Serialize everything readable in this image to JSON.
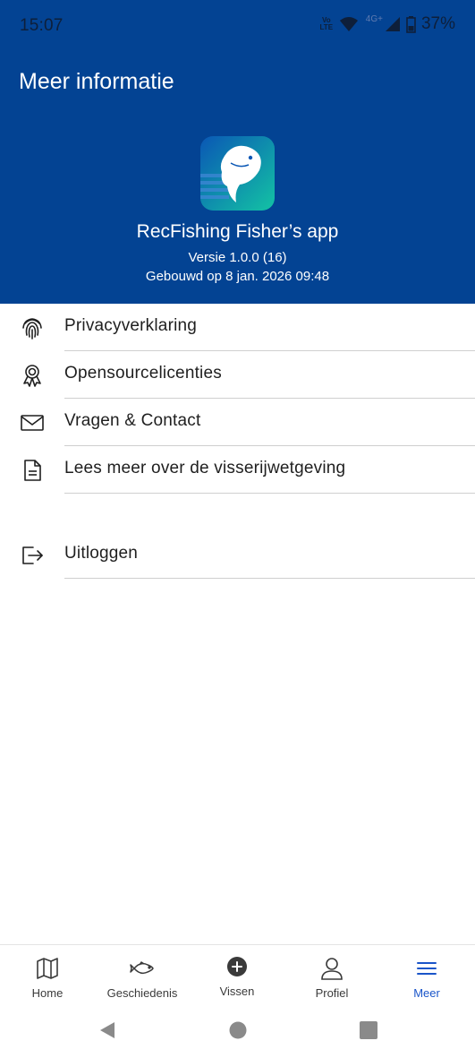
{
  "status_bar": {
    "time": "15:07",
    "volte": "Vo LTE",
    "network": "4G+",
    "battery": "37%"
  },
  "header": {
    "title": "Meer informatie",
    "app_name": "RecFishing Fisher’s app",
    "version": "Versie 1.0.0 (16)",
    "built": "Gebouwd op 8 jan. 2026 09:48",
    "background_color": "#034393"
  },
  "menu": {
    "items": [
      {
        "label": "Privacyverklaring",
        "icon": "fingerprint-icon"
      },
      {
        "label": "Opensourcelicenties",
        "icon": "award-ribbon-icon"
      },
      {
        "label": "Vragen & Contact",
        "icon": "mail-icon"
      },
      {
        "label": "Lees meer over de visserijwetgeving",
        "icon": "document-icon"
      }
    ],
    "logout": {
      "label": "Uitloggen",
      "icon": "logout-icon"
    }
  },
  "bottom_nav": {
    "items": [
      {
        "label": "Home",
        "icon": "map-icon"
      },
      {
        "label": "Geschiedenis",
        "icon": "fish-icon"
      },
      {
        "label": "Vissen",
        "icon": "plus-circle-icon"
      },
      {
        "label": "Profiel",
        "icon": "person-icon"
      },
      {
        "label": "Meer",
        "icon": "menu-icon",
        "active": true
      }
    ],
    "active_color": "#1a55c9"
  }
}
